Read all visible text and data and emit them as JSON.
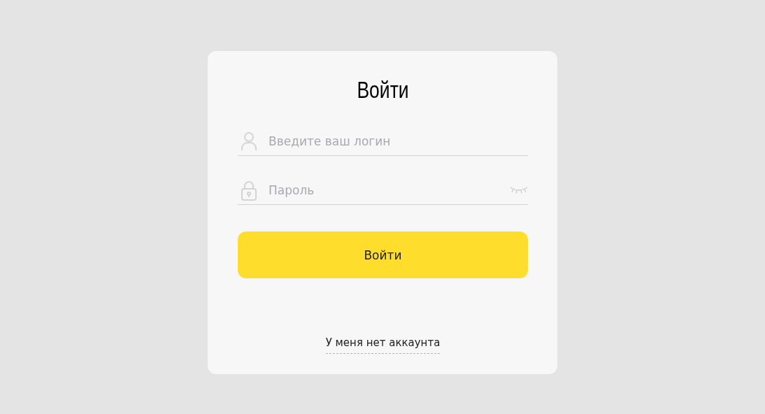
{
  "title": "Войти",
  "fields": [
    {
      "kind": "login",
      "placeholder": "Введите ваш логин"
    },
    {
      "kind": "password",
      "placeholder": "Пароль",
      "password_visible": false
    }
  ],
  "submit": "Войти",
  "register_link": "У меня нет аккаунта"
}
